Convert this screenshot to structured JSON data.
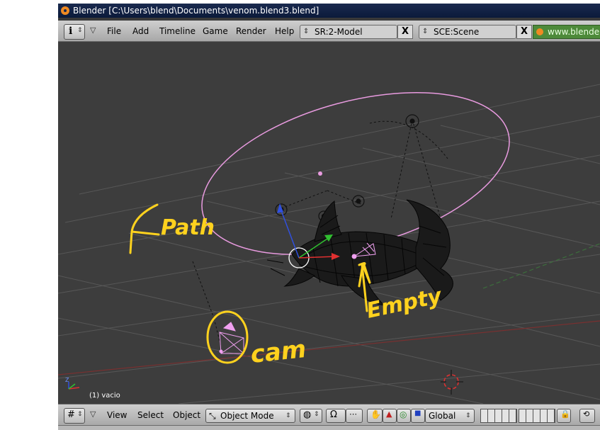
{
  "window": {
    "title": "Blender [C:\\Users\\blend\\Documents\\venom.blend3.blend]"
  },
  "menubar": {
    "items": [
      "File",
      "Add",
      "Timeline",
      "Game",
      "Render",
      "Help"
    ],
    "screen_field": "SR:2-Model",
    "scene_field": "SCE:Scene",
    "close_glyph": "X",
    "website": "www.blender"
  },
  "viewport": {
    "status": "(1) vacio",
    "axis_labels": {
      "z": "Z",
      "y": "Y",
      "x": "X"
    },
    "annotations": {
      "path": "Path",
      "empty": "Empty",
      "cam": "cam"
    },
    "colors": {
      "background": "#3d3d3d",
      "grid": "#575757",
      "path": "#ff88e0",
      "annotation": "#ffd21e",
      "wire": "#000000"
    }
  },
  "bottombar": {
    "view": "View",
    "select": "Select",
    "object": "Object",
    "mode": "Object Mode",
    "orientation": "Global"
  }
}
